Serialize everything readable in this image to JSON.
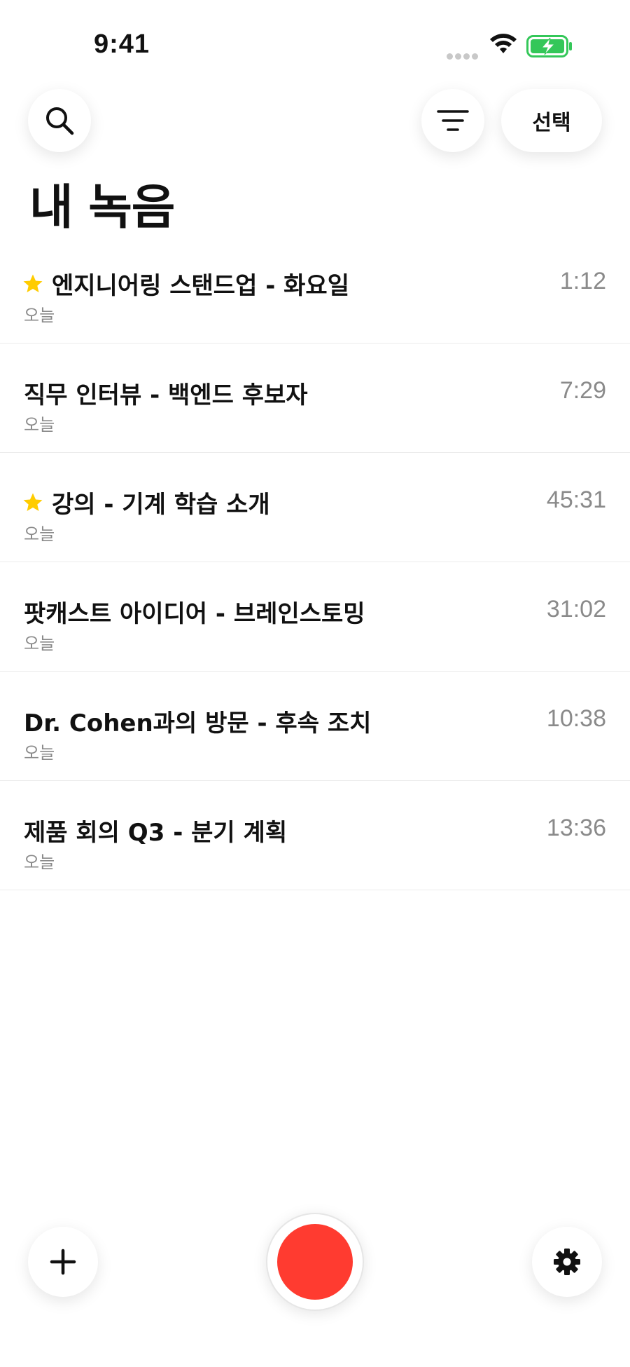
{
  "status_bar": {
    "time": "9:41",
    "icons": [
      "signal-dots-icon",
      "wifi-icon",
      "battery-charging-icon"
    ],
    "battery_color": "#34c759"
  },
  "header": {
    "search_icon": "search-icon",
    "filter_icon": "filter-lines-icon",
    "select_label": "선택",
    "title": "내 녹음"
  },
  "recordings": [
    {
      "title": "엔지니어링 스탠드업 - 화요일",
      "date": "오늘",
      "duration": "1:12",
      "starred": true
    },
    {
      "title": "직무 인터뷰 - 백엔드 후보자",
      "date": "오늘",
      "duration": "7:29",
      "starred": false
    },
    {
      "title": "강의 - 기계 학습 소개",
      "date": "오늘",
      "duration": "45:31",
      "starred": true
    },
    {
      "title": "팟캐스트 아이디어 - 브레인스토밍",
      "date": "오늘",
      "duration": "31:02",
      "starred": false
    },
    {
      "title": "Dr. Cohen과의 방문 - 후속 조치",
      "date": "오늘",
      "duration": "10:38",
      "starred": false
    },
    {
      "title": "제품 회의 Q3 - 분기 계획",
      "date": "오늘",
      "duration": "13:36",
      "starred": false
    }
  ],
  "bottom_bar": {
    "add_icon": "plus-icon",
    "record_icon": "record-icon",
    "settings_icon": "gear-icon"
  },
  "colors": {
    "star": "#ffcc00",
    "record": "#ff3b30",
    "secondary_text": "#8a8a8a"
  }
}
